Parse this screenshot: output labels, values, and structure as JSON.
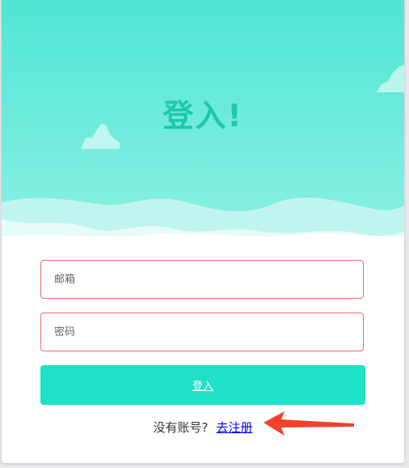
{
  "login": {
    "title": "登入!",
    "email_placeholder": "邮箱",
    "password_placeholder": "密码",
    "submit_label": "登入",
    "no_account_text": "没有账号?",
    "register_link": "去注册"
  },
  "colors": {
    "accent": "#1dc9ac",
    "button": "#1fe0c8",
    "input_border": "#ec6a72",
    "annotation_arrow": "#f0422c"
  }
}
